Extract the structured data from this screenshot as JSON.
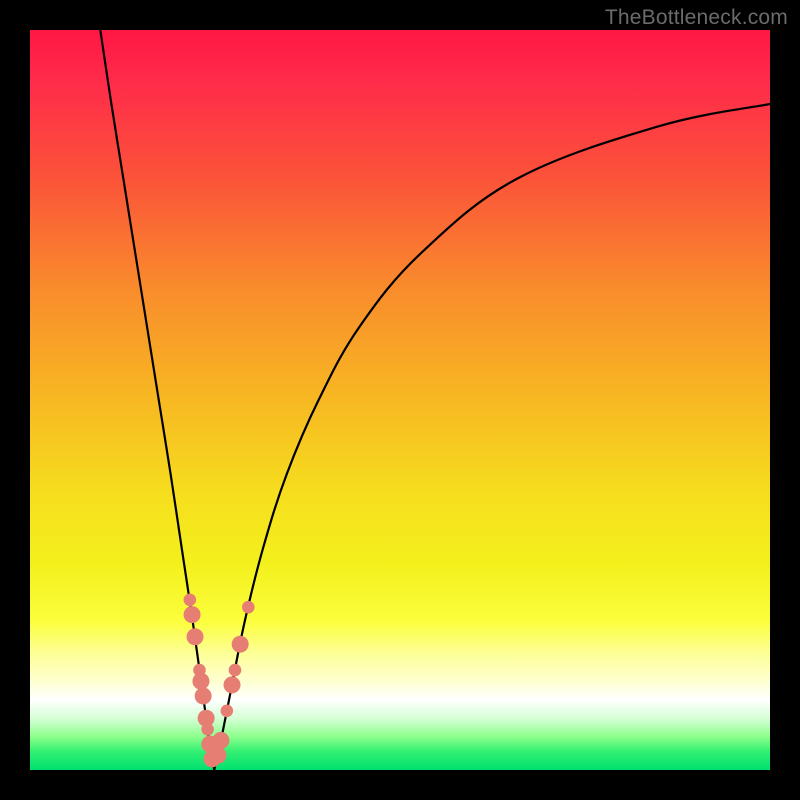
{
  "watermark": {
    "text": "TheBottleneck.com"
  },
  "chart_data": {
    "type": "line",
    "title": "",
    "xlabel": "",
    "ylabel": "",
    "xlim": [
      0,
      100
    ],
    "ylim": [
      0,
      100
    ],
    "grid": false,
    "legend": false,
    "notes": "V-shaped bottleneck curve over red-to-green vertical gradient. No axes, ticks, or labels shown. Units unspecified.",
    "gradient_stops": [
      {
        "pos": 0,
        "color": "#ff1744"
      },
      {
        "pos": 0.07,
        "color": "#ff2b4a"
      },
      {
        "pos": 0.2,
        "color": "#fb5339"
      },
      {
        "pos": 0.35,
        "color": "#f98c2c"
      },
      {
        "pos": 0.5,
        "color": "#f7b822"
      },
      {
        "pos": 0.63,
        "color": "#f6df1e"
      },
      {
        "pos": 0.72,
        "color": "#f3f01c"
      },
      {
        "pos": 0.8,
        "color": "#fcfe3e"
      },
      {
        "pos": 0.84,
        "color": "#fdff93"
      },
      {
        "pos": 0.88,
        "color": "#feffd0"
      },
      {
        "pos": 0.905,
        "color": "#ffffff"
      },
      {
        "pos": 0.93,
        "color": "#d6ffd6"
      },
      {
        "pos": 0.955,
        "color": "#8cff8c"
      },
      {
        "pos": 0.975,
        "color": "#33f072"
      },
      {
        "pos": 1.0,
        "color": "#00e070"
      }
    ],
    "series": [
      {
        "name": "left-branch",
        "path_note": "steep descent from upper-left edge to valley floor",
        "points": [
          {
            "x": 9.5,
            "y": 100
          },
          {
            "x": 11.0,
            "y": 90
          },
          {
            "x": 12.6,
            "y": 80
          },
          {
            "x": 14.2,
            "y": 70
          },
          {
            "x": 15.8,
            "y": 60
          },
          {
            "x": 17.4,
            "y": 50
          },
          {
            "x": 19.0,
            "y": 40
          },
          {
            "x": 20.5,
            "y": 30
          },
          {
            "x": 22.0,
            "y": 20
          },
          {
            "x": 23.4,
            "y": 10
          },
          {
            "x": 24.2,
            "y": 4
          },
          {
            "x": 24.9,
            "y": 0
          }
        ]
      },
      {
        "name": "right-branch",
        "path_note": "initial steep rise out of valley then decelerating saturating curve toward upper-right",
        "points": [
          {
            "x": 24.9,
            "y": 0
          },
          {
            "x": 25.8,
            "y": 4
          },
          {
            "x": 27.0,
            "y": 10
          },
          {
            "x": 29.0,
            "y": 20
          },
          {
            "x": 31.5,
            "y": 30
          },
          {
            "x": 34.7,
            "y": 40
          },
          {
            "x": 39.0,
            "y": 50
          },
          {
            "x": 44.6,
            "y": 60
          },
          {
            "x": 53.0,
            "y": 70
          },
          {
            "x": 66.0,
            "y": 80
          },
          {
            "x": 85.0,
            "y": 87
          },
          {
            "x": 100,
            "y": 90
          }
        ]
      }
    ],
    "markers": {
      "note": "salmon-colored dots clustered near the valley bottom on both branches",
      "color": "#e77e74",
      "r_small": 0.85,
      "r_large": 1.15,
      "points": [
        {
          "branch": "left",
          "x": 21.6,
          "y": 23.0,
          "r": 0.85
        },
        {
          "branch": "left",
          "x": 21.9,
          "y": 21.0,
          "r": 1.15
        },
        {
          "branch": "left",
          "x": 22.3,
          "y": 18.0,
          "r": 1.15
        },
        {
          "branch": "left",
          "x": 22.9,
          "y": 13.5,
          "r": 0.85
        },
        {
          "branch": "left",
          "x": 23.1,
          "y": 12.0,
          "r": 1.15
        },
        {
          "branch": "left",
          "x": 23.4,
          "y": 10.0,
          "r": 1.15
        },
        {
          "branch": "left",
          "x": 23.8,
          "y": 7.0,
          "r": 1.15
        },
        {
          "branch": "left",
          "x": 24.0,
          "y": 5.5,
          "r": 0.85
        },
        {
          "branch": "left",
          "x": 24.3,
          "y": 3.5,
          "r": 1.15
        },
        {
          "branch": "left",
          "x": 24.6,
          "y": 1.5,
          "r": 1.15
        },
        {
          "branch": "right",
          "x": 25.4,
          "y": 2.0,
          "r": 1.15
        },
        {
          "branch": "right",
          "x": 25.8,
          "y": 4.0,
          "r": 1.15
        },
        {
          "branch": "right",
          "x": 26.6,
          "y": 8.0,
          "r": 0.85
        },
        {
          "branch": "right",
          "x": 27.3,
          "y": 11.5,
          "r": 1.15
        },
        {
          "branch": "right",
          "x": 27.7,
          "y": 13.5,
          "r": 0.85
        },
        {
          "branch": "right",
          "x": 28.4,
          "y": 17.0,
          "r": 1.15
        },
        {
          "branch": "right",
          "x": 29.5,
          "y": 22.0,
          "r": 0.85
        }
      ]
    }
  }
}
